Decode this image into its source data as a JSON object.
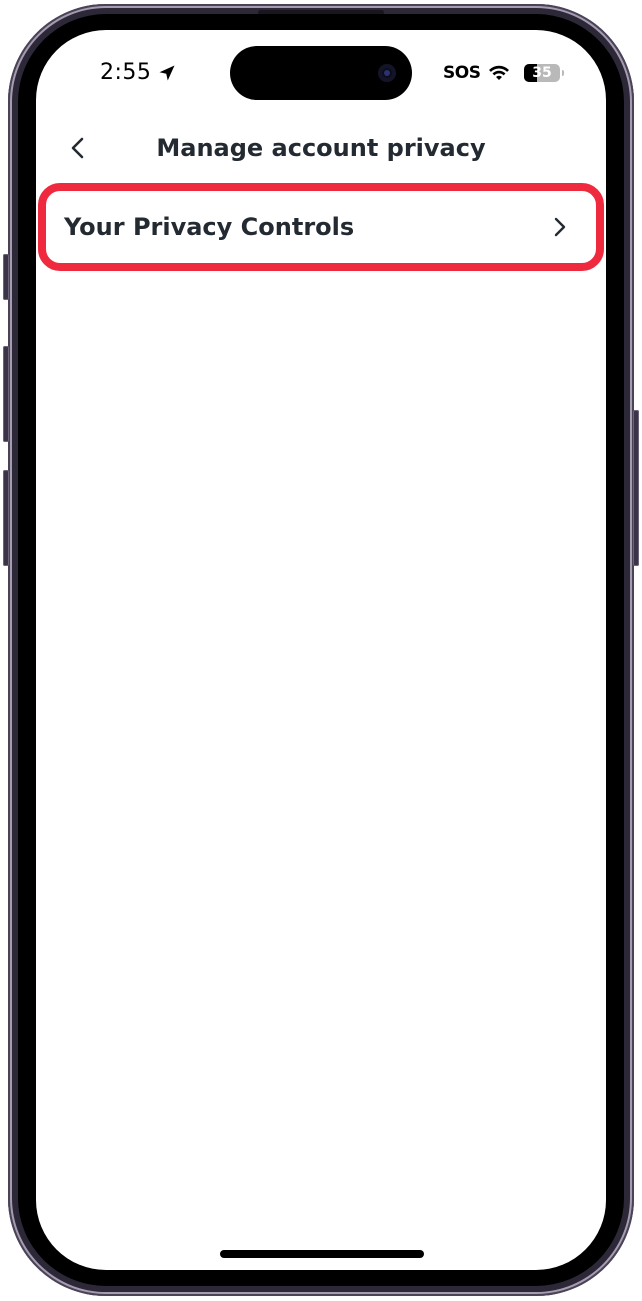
{
  "status_bar": {
    "time": "2:55",
    "location_icon": "location-arrow-icon",
    "carrier_status": "SOS",
    "wifi_icon": "wifi-icon",
    "battery_level": "35",
    "battery_fraction": 0.35
  },
  "header": {
    "back_icon": "chevron-left-icon",
    "title": "Manage account privacy"
  },
  "list": {
    "items": [
      {
        "label": "Your Privacy Controls",
        "icon": "chevron-right-icon",
        "highlighted": true
      }
    ]
  },
  "colors": {
    "highlight": "#ef2a3f",
    "text_primary": "#232a31",
    "background": "#ffffff"
  }
}
